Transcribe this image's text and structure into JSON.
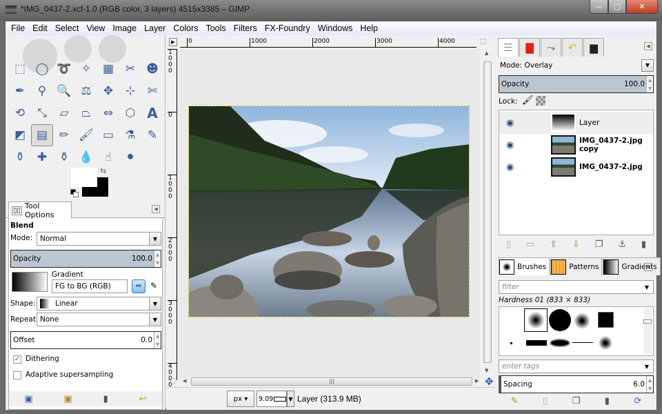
{
  "window": {
    "title": "*IMG_0437-2.xcf-1.0 (RGB color, 3 layers) 4515x3385 – GIMP",
    "controls": {
      "minimize": "—",
      "maximize": "▢",
      "close": "✕"
    }
  },
  "menu": [
    "File",
    "Edit",
    "Select",
    "View",
    "Image",
    "Layer",
    "Colors",
    "Tools",
    "Filters",
    "FX-Foundry",
    "Windows",
    "Help"
  ],
  "toolbox": {
    "tools": [
      {
        "name": "rect-select",
        "glyph": "⬚"
      },
      {
        "name": "ellipse-select",
        "glyph": "◯"
      },
      {
        "name": "free-select",
        "glyph": "➰"
      },
      {
        "name": "fuzzy-select",
        "glyph": "✧"
      },
      {
        "name": "select-by-color",
        "glyph": "▦"
      },
      {
        "name": "scissors-select",
        "glyph": "✂"
      },
      {
        "name": "foreground-select",
        "glyph": "☻"
      },
      {
        "name": "paths",
        "glyph": "✒"
      },
      {
        "name": "color-picker",
        "glyph": "⚲"
      },
      {
        "name": "zoom",
        "glyph": "🔍"
      },
      {
        "name": "measure",
        "glyph": "⚖"
      },
      {
        "name": "move",
        "glyph": "✥"
      },
      {
        "name": "align",
        "glyph": "⊹"
      },
      {
        "name": "crop",
        "glyph": "✄"
      },
      {
        "name": "rotate",
        "glyph": "⟲"
      },
      {
        "name": "scale",
        "glyph": "⤡"
      },
      {
        "name": "shear",
        "glyph": "▱"
      },
      {
        "name": "perspective",
        "glyph": "⏢"
      },
      {
        "name": "flip",
        "glyph": "⇔"
      },
      {
        "name": "cage-transform",
        "glyph": "⬡"
      },
      {
        "name": "text",
        "glyph": "A"
      },
      {
        "name": "bucket-fill",
        "glyph": "◩"
      },
      {
        "name": "blend",
        "glyph": "▤"
      },
      {
        "name": "pencil",
        "glyph": "✏"
      },
      {
        "name": "paintbrush",
        "glyph": "🖌"
      },
      {
        "name": "eraser",
        "glyph": "▭"
      },
      {
        "name": "airbrush",
        "glyph": "⚗"
      },
      {
        "name": "ink",
        "glyph": "✎"
      },
      {
        "name": "clone",
        "glyph": "⚱"
      },
      {
        "name": "heal",
        "glyph": "✚"
      },
      {
        "name": "perspective-clone",
        "glyph": "⚱"
      },
      {
        "name": "blur-sharpen",
        "glyph": "💧"
      },
      {
        "name": "smudge",
        "glyph": "☝"
      },
      {
        "name": "dodge-burn",
        "glyph": "⚫"
      }
    ],
    "active_tool": "blend",
    "fg_color": "#ffffff",
    "bg_color": "#000000"
  },
  "tool_options": {
    "tab_label": "Tool Options",
    "section": "Blend",
    "mode_label": "Mode:",
    "mode_value": "Normal",
    "opacity_label": "Opacity",
    "opacity_value": "100.0",
    "gradient_label": "Gradient",
    "gradient_value": "FG to BG (RGB)",
    "shape_label": "Shape:",
    "shape_value": "Linear",
    "repeat_label": "Repeat:",
    "repeat_value": "None",
    "offset_label": "Offset",
    "offset_value": "0.0",
    "dithering_label": "Dithering",
    "dithering_checked": true,
    "adaptive_label": "Adaptive supersampling",
    "adaptive_checked": false,
    "footer_icons": [
      "save-icon",
      "restore-icon",
      "delete-icon",
      "reset-icon"
    ]
  },
  "canvas": {
    "hruler_ticks": [
      "0",
      "1000",
      "2000",
      "3000",
      "4000"
    ],
    "vruler_ticks": [
      "1000",
      "0",
      "1000",
      "2000",
      "3000",
      "4000"
    ],
    "unit": "px",
    "zoom": "9.09",
    "status": "Layer (313.9 MB)"
  },
  "layers_panel": {
    "mode_label": "Mode:",
    "mode_value": "Overlay",
    "opacity_label": "Opacity",
    "opacity_value": "100.0",
    "lock_label": "Lock:",
    "layers": [
      {
        "name": "Layer",
        "visible": true,
        "selected": true,
        "bold": false
      },
      {
        "name": "IMG_0437-2.jpg copy",
        "visible": true,
        "selected": false,
        "bold": true
      },
      {
        "name": "IMG_0437-2.jpg",
        "visible": true,
        "selected": false,
        "bold": true
      }
    ]
  },
  "brushes_panel": {
    "tabs": [
      "Brushes",
      "Patterns",
      "Gradients"
    ],
    "filter_placeholder": "filter",
    "brush_name": "Hardness 01 (833 × 833)",
    "tags_placeholder": "enter tags",
    "spacing_label": "Spacing",
    "spacing_value": "6.0"
  }
}
